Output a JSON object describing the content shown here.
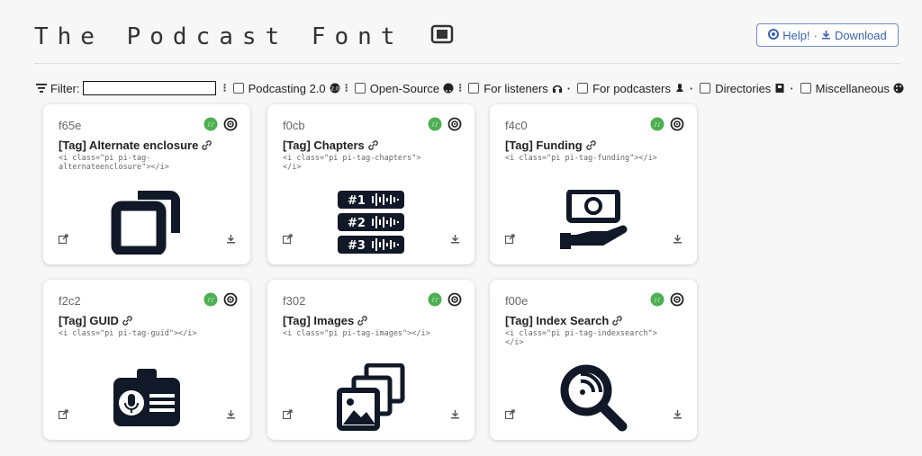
{
  "header": {
    "title": "The Podcast Font",
    "help_label": "Help!",
    "separator": "·",
    "download_label": "Download"
  },
  "filter": {
    "label": "Filter:",
    "value": "",
    "categories": [
      {
        "label": "Podcasting 2.0"
      },
      {
        "label": "Open-Source"
      },
      {
        "label": "For listeners"
      },
      {
        "label": "For podcasters"
      },
      {
        "label": "Directories"
      },
      {
        "label": "Miscellaneous"
      }
    ]
  },
  "cards": [
    {
      "code": "f65e",
      "name": "[Tag] Alternate enclosure",
      "snippet": "<i class=\"pi pi-tag-\nalternateenclosure\"></i>",
      "icon": "alternate-enclosure-icon"
    },
    {
      "code": "f0cb",
      "name": "[Tag] Chapters",
      "snippet": "<i class=\"pi pi-tag-chapters\">\n</i>",
      "icon": "chapters-icon"
    },
    {
      "code": "f4c0",
      "name": "[Tag] Funding",
      "snippet": "<i class=\"pi pi-tag-funding\"></i>",
      "icon": "funding-icon"
    },
    {
      "code": "f2c2",
      "name": "[Tag] GUID",
      "snippet": "<i class=\"pi pi-tag-guid\"></i>",
      "icon": "guid-icon"
    },
    {
      "code": "f302",
      "name": "[Tag] Images",
      "snippet": "<i class=\"pi pi-tag-images\"></i>",
      "icon": "images-icon"
    },
    {
      "code": "f00e",
      "name": "[Tag] Index Search",
      "snippet": "<i class=\"pi pi-tag-indexsearch\">\n</i>",
      "icon": "index-search-icon"
    }
  ],
  "chapter_labels": [
    "#1",
    "#2",
    "#3"
  ],
  "colors": {
    "badge_green": "#4caf50",
    "accent_blue": "#3a63b6",
    "icon_dark": "#111827"
  }
}
